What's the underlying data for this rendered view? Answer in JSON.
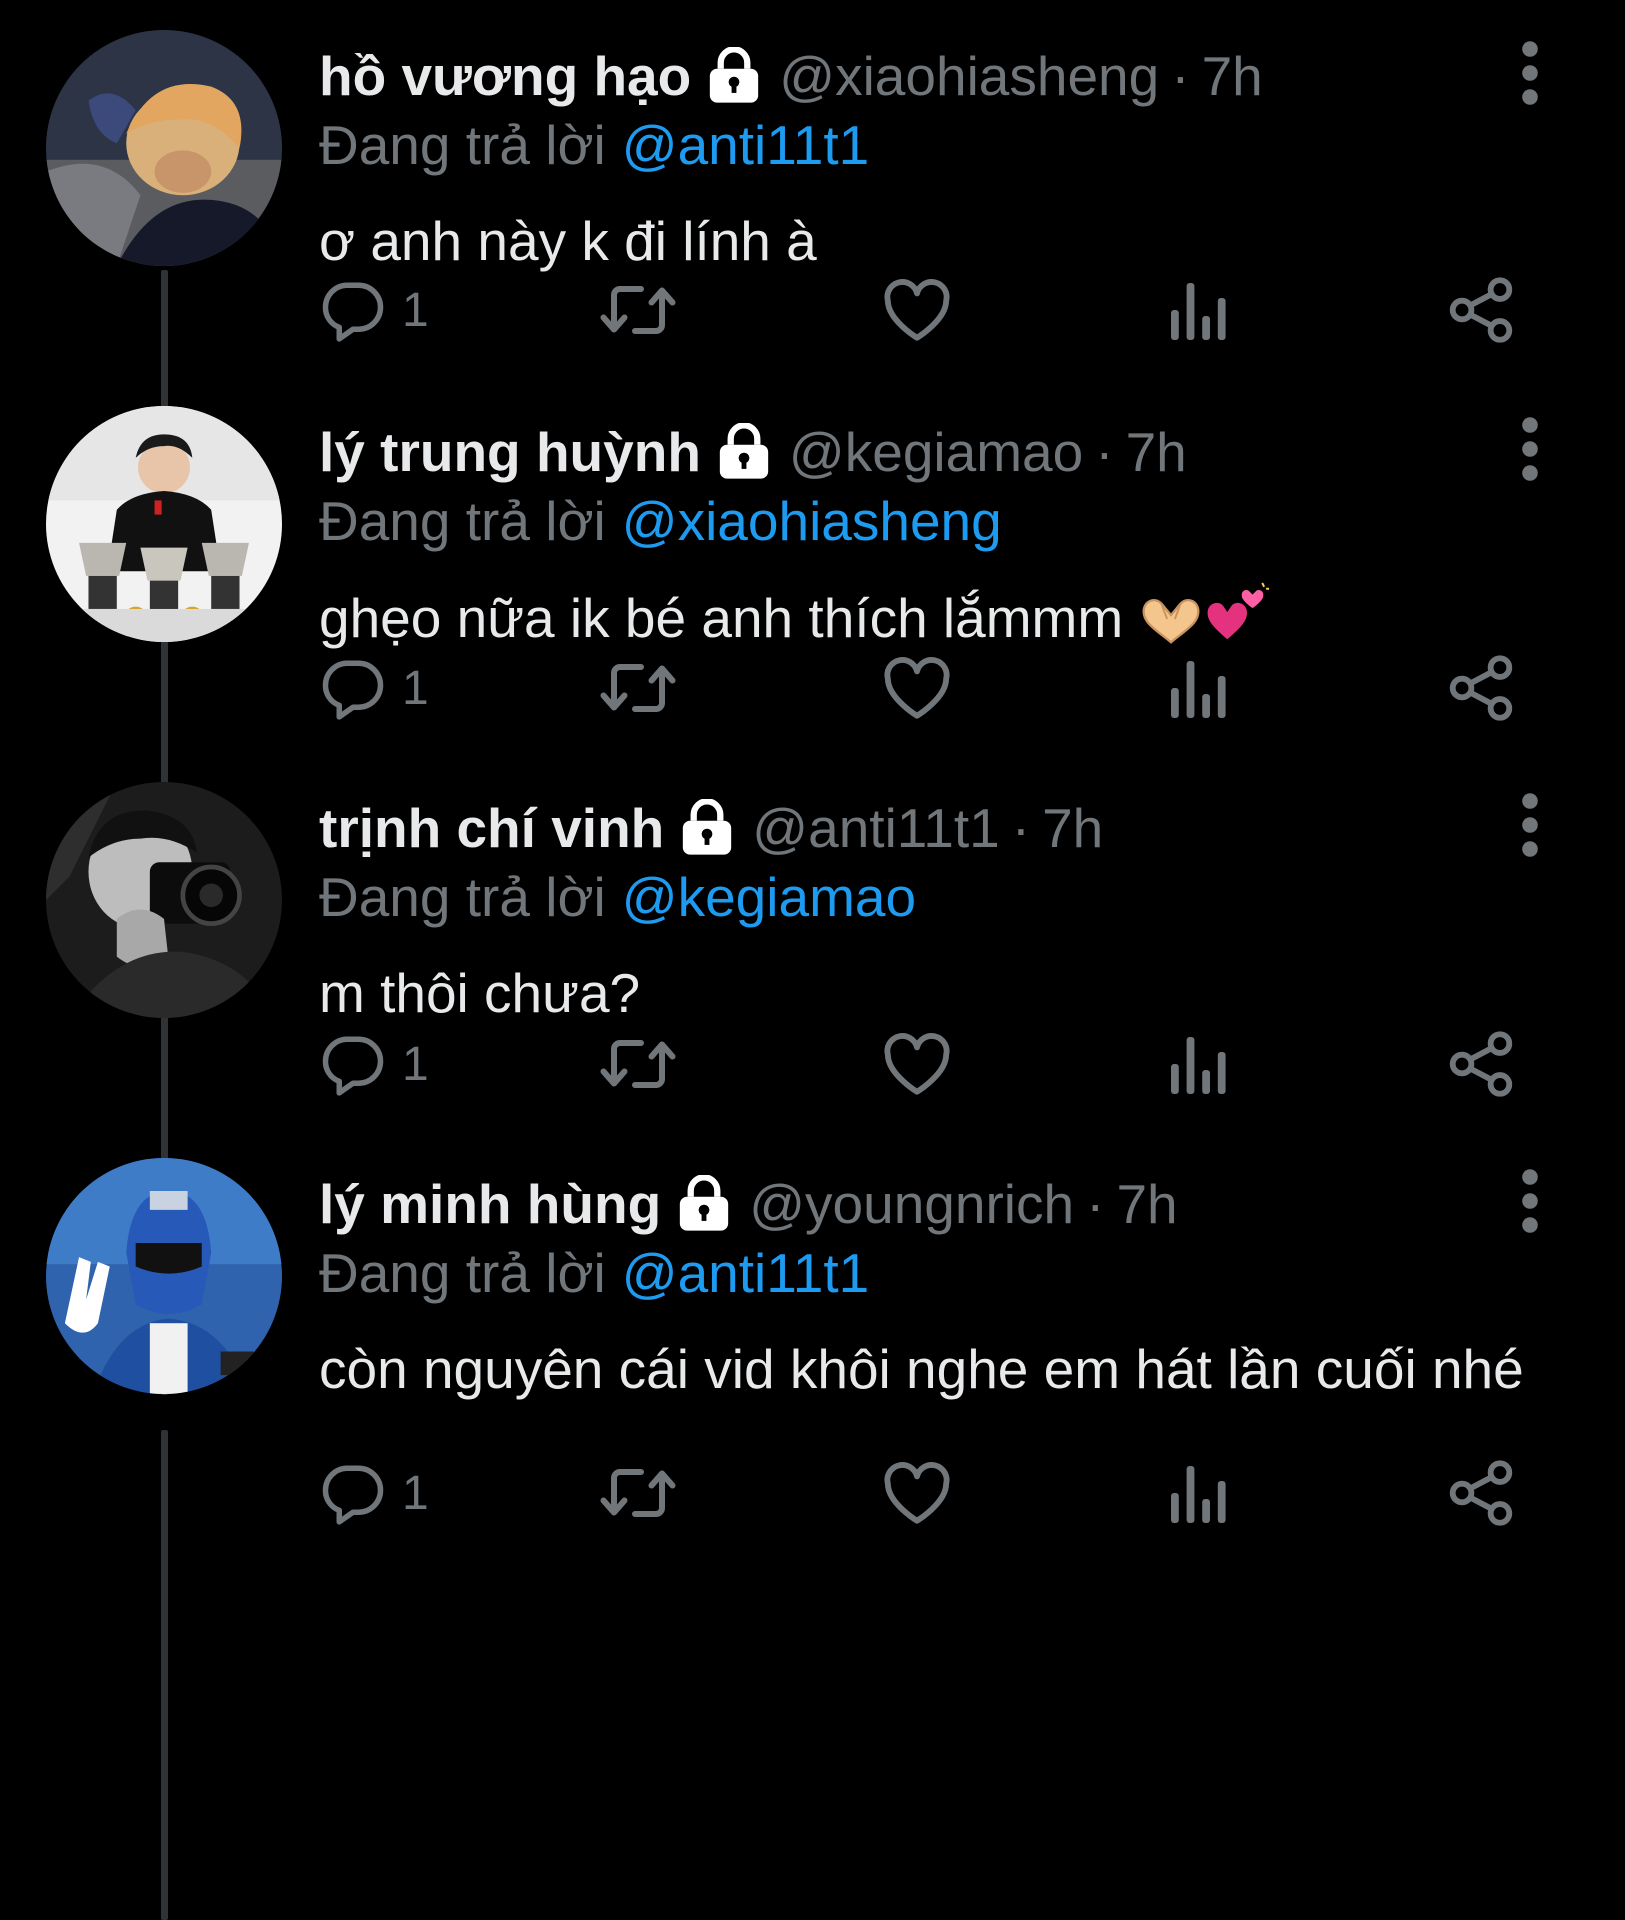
{
  "reply_prefix": "Đang trả lời",
  "colors": {
    "background": "#000000",
    "text": "#e7e9ea",
    "muted": "#71767b",
    "link": "#1d9bf0",
    "thread_line": "#2f3336"
  },
  "icons": {
    "lock": "lock-icon",
    "more": "more-vertical-icon",
    "reply": "reply-bubble-icon",
    "retweet": "retweet-icon",
    "like": "heart-icon",
    "views": "bar-chart-icon",
    "share": "share-icon"
  },
  "tweets": [
    {
      "display_name": "hồ vương hạo",
      "handle": "@xiaohiasheng",
      "separator": "·",
      "time": "7h",
      "reply_to": "@anti11t1",
      "text": "ơ anh này k đi lính à",
      "emoji": [],
      "reply_count": "1",
      "avatar": "avatar-blonde-person"
    },
    {
      "display_name": "lý trung huỳnh",
      "handle": "@kegiamao",
      "separator": "·",
      "time": "7h",
      "reply_to": "@xiaohiasheng",
      "text": "ghẹo nữa ik bé anh thích lắmmm",
      "emoji": [
        "heart-hands-emoji",
        "two-hearts-emoji"
      ],
      "reply_count": "1",
      "avatar": "avatar-person-with-trophies"
    },
    {
      "display_name": "trịnh chí vinh",
      "handle": "@anti11t1",
      "separator": "·",
      "time": "7h",
      "reply_to": "@kegiamao",
      "text": "m thôi chưa?",
      "emoji": [],
      "reply_count": "1",
      "avatar": "avatar-person-with-camera"
    },
    {
      "display_name": "lý minh hùng",
      "handle": "@youngnrich",
      "separator": "·",
      "time": "7h",
      "reply_to": "@anti11t1",
      "text": "còn nguyên cái vid khôi nghe em hát lần cuối nhé",
      "emoji": [],
      "reply_count": "1",
      "avatar": "avatar-blue-ranger"
    }
  ]
}
